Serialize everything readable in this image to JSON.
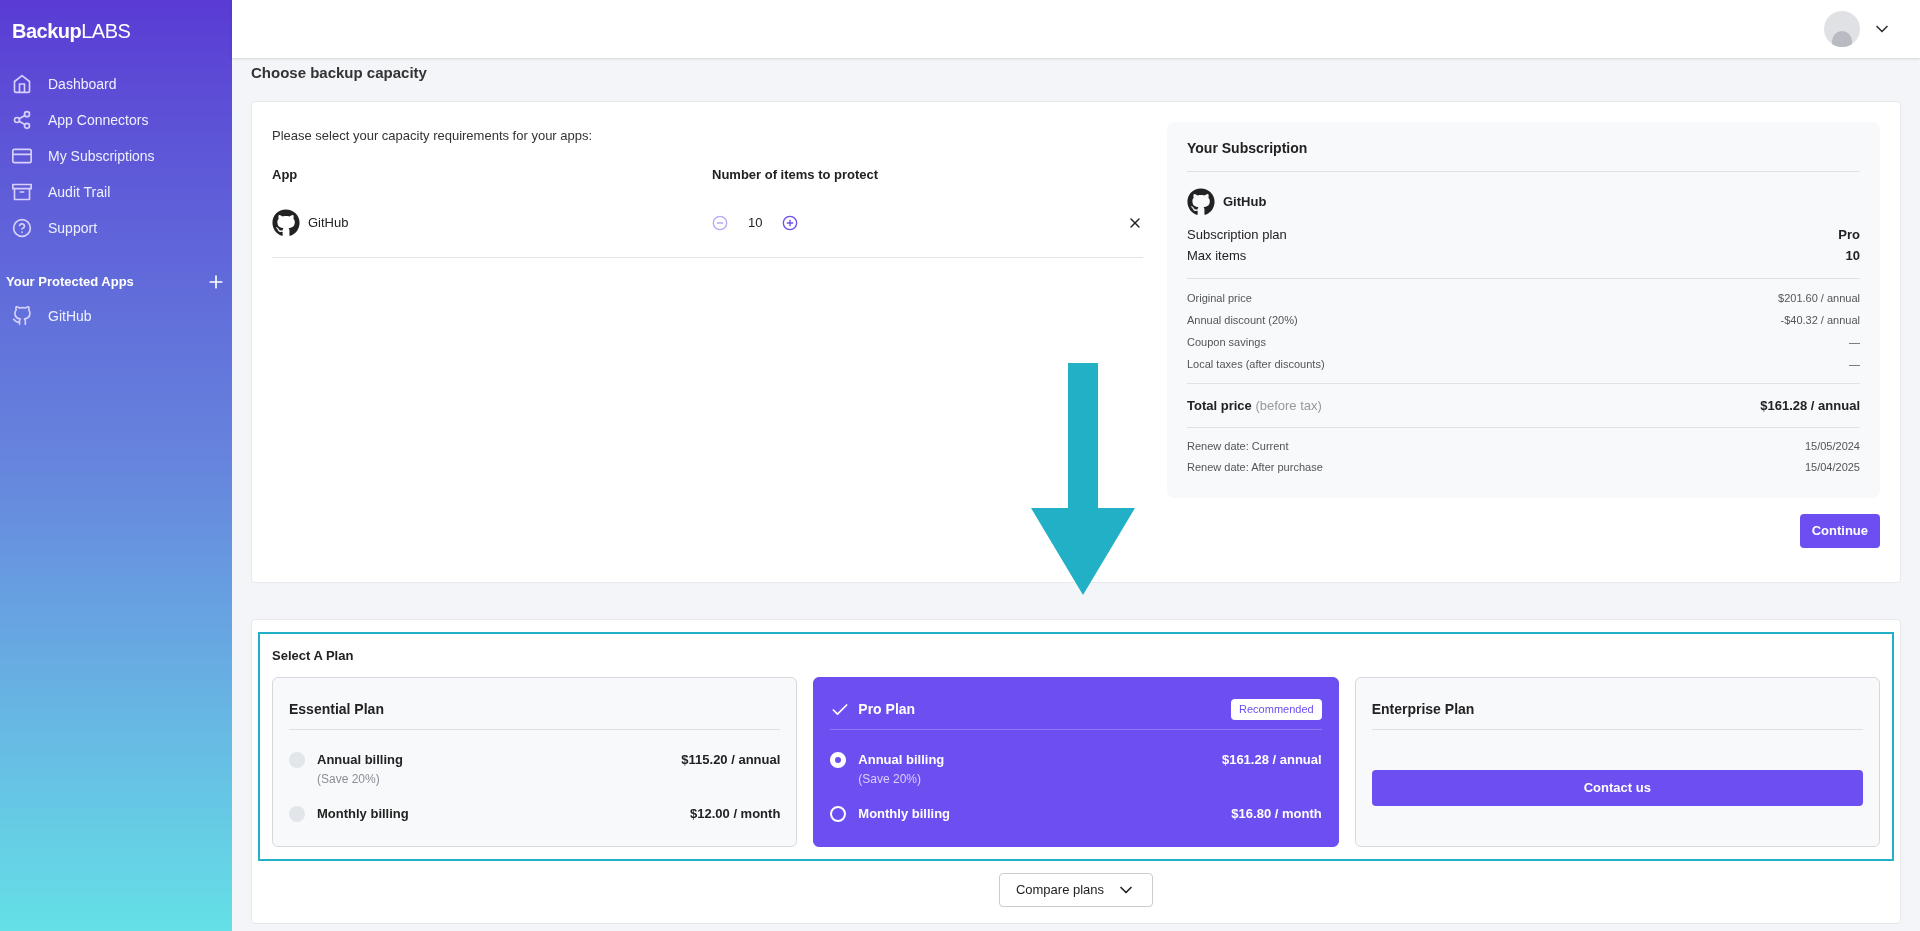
{
  "sidebar": {
    "logo": {
      "bold": "Backup",
      "light": "LABS"
    },
    "nav": [
      {
        "label": "Dashboard"
      },
      {
        "label": "App Connectors"
      },
      {
        "label": "My Subscriptions"
      },
      {
        "label": "Audit Trail"
      },
      {
        "label": "Support"
      }
    ],
    "section_title": "Your Protected Apps",
    "apps": [
      {
        "label": "GitHub"
      }
    ]
  },
  "page_title": "Choose backup capacity",
  "capacity": {
    "instruction": "Please select your capacity requirements for your apps:",
    "columns": [
      "App",
      "Number of items to protect"
    ],
    "rows": [
      {
        "app": "GitHub",
        "count": "10"
      }
    ]
  },
  "subscription": {
    "title": "Your Subscription",
    "app": "GitHub",
    "details": [
      {
        "label": "Subscription plan",
        "value": "Pro"
      },
      {
        "label": "Max items",
        "value": "10"
      }
    ],
    "price_lines": [
      {
        "label": "Original price",
        "value": "$201.60 / annual"
      },
      {
        "label": "Annual discount (20%)",
        "value": "-$40.32 / annual"
      },
      {
        "label": "Coupon savings",
        "value": "—"
      },
      {
        "label": "Local taxes (after discounts)",
        "value": "—"
      }
    ],
    "total": {
      "label": "Total price",
      "note": "(before tax)",
      "value": "$161.28 / annual"
    },
    "renew": [
      {
        "label": "Renew date: Current",
        "value": "15/05/2024"
      },
      {
        "label": "Renew date: After purchase",
        "value": "15/04/2025"
      }
    ],
    "continue": "Continue"
  },
  "plans": {
    "title": "Select A Plan",
    "items": [
      {
        "kind": "billing",
        "name": "Essential Plan",
        "selected": false,
        "options": [
          {
            "label": "Annual billing",
            "note": "(Save 20%)",
            "price": "$115.20 / annual",
            "selected": false
          },
          {
            "label": "Monthly billing",
            "price": "$12.00 / month",
            "selected": false
          }
        ]
      },
      {
        "kind": "billing",
        "name": "Pro Plan",
        "selected": true,
        "badge": "Recommended",
        "options": [
          {
            "label": "Annual billing",
            "note": "(Save 20%)",
            "price": "$161.28 / annual",
            "selected": true
          },
          {
            "label": "Monthly billing",
            "price": "$16.80 / month",
            "selected": false
          }
        ]
      },
      {
        "kind": "contact",
        "name": "Enterprise Plan",
        "selected": false,
        "button": "Contact us"
      }
    ],
    "compare": "Compare plans"
  }
}
